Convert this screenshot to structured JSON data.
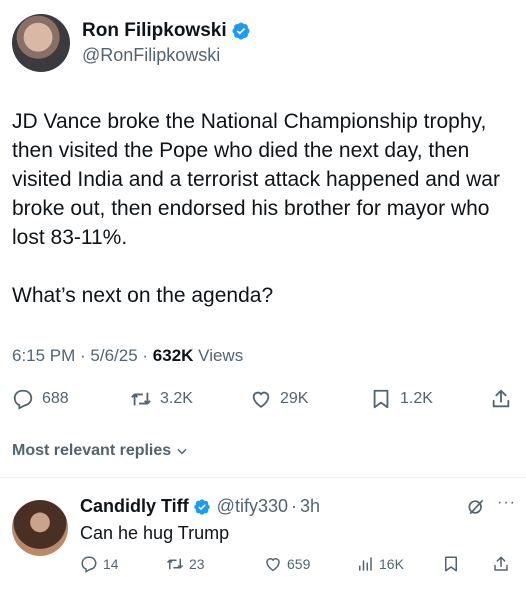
{
  "author": {
    "display_name": "Ron Filipkowski",
    "handle": "@RonFilipkowski"
  },
  "tweet": {
    "text": "JD Vance broke the National Championship trophy, then visited the Pope who died the next day, then visited India and a terrorist attack happened and war broke out, then endorsed his brother for mayor who lost 83-11%.\n\nWhat’s next on the agenda?",
    "time": "6:15 PM",
    "date": "5/6/25",
    "views_count": "632K",
    "views_label": "Views"
  },
  "actions": {
    "replies": "688",
    "reposts": "3.2K",
    "likes": "29K",
    "bookmarks": "1.2K"
  },
  "replies_sort_label": "Most relevant replies",
  "reply": {
    "display_name": "Candidly Tiff",
    "handle": "@tify330",
    "time": "3h",
    "text": "Can he hug Trump",
    "replies": "14",
    "reposts": "23",
    "likes": "659",
    "views": "16K"
  },
  "colors": {
    "verified": "#1d9bf0",
    "secondary_text": "#536471",
    "primary_text": "#0f1419"
  },
  "icons": [
    "verified-badge-icon",
    "reply-icon",
    "repost-icon",
    "like-icon",
    "bookmark-icon",
    "share-icon",
    "chevron-down-icon",
    "grok-icon",
    "more-icon",
    "views-icon"
  ]
}
